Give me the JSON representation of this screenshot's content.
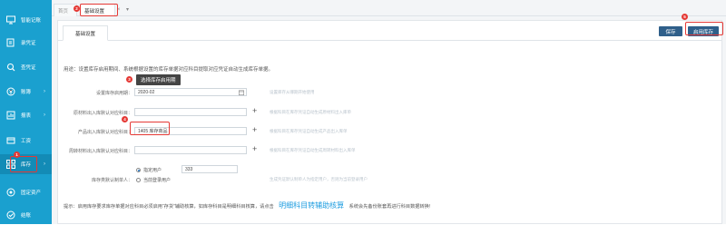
{
  "sidebar": {
    "items": [
      {
        "label": "智能记账",
        "icon": "monitor-icon",
        "has_arrow": false
      },
      {
        "label": "录凭证",
        "icon": "edit-voucher-icon",
        "has_arrow": false
      },
      {
        "label": "查凭证",
        "icon": "search-voucher-icon",
        "has_arrow": false
      },
      {
        "label": "账簿",
        "icon": "ledger-icon",
        "has_arrow": true
      },
      {
        "label": "报表",
        "icon": "report-icon",
        "has_arrow": true
      },
      {
        "label": "工资",
        "icon": "salary-icon",
        "has_arrow": false
      },
      {
        "label": "库存",
        "icon": "inventory-icon",
        "has_arrow": true
      },
      {
        "label": "固定资产",
        "icon": "asset-icon",
        "has_arrow": false
      },
      {
        "label": "结账",
        "icon": "close-account-icon",
        "has_arrow": false
      }
    ]
  },
  "tabs": {
    "home": "首页",
    "active": "基础设置",
    "close_glyph": "×",
    "more_glyph": "▾"
  },
  "panel": {
    "tab": "基础设置",
    "save_label": "保存",
    "enable_label": "启用库存"
  },
  "form": {
    "usage_text": "用途：设置库存启用期间、系统根据设置的库存单据对应科目提取对应凭证自动生成库存单据。",
    "start_period_label": "设置库存启用期：",
    "start_period_value": "2020-02",
    "raw_material_label": "原材料出入库默认对应科目：",
    "raw_material_value": "",
    "raw_material_hint": "根据科目在库存凭证自动生成原材料出入库单",
    "product_label": "产品出入库默认对应科目：",
    "product_value": "1405 库存商品",
    "product_hint": "根据科目在库存凭证自动生成产品出入库单",
    "turnover_label": "周转材料出入库默认对应科目：",
    "turnover_value": "",
    "turnover_hint": "根据科目在库存凭证自动生成周转材料出入库单",
    "default_user_label": "库存类默认制单人：",
    "radio_fixed": "指定用户",
    "radio_current": "当前登录用户",
    "fixed_user_value": "333",
    "default_user_hint": "生成凭证默认制单人为指定用户，否则为当前登录用户",
    "tooltip": "选择库存启用期",
    "footer_prefix": "提示：启用库存要求库存单据对应科目必须启用“存货”辅助核算，如库存科目是明细科目核算，请点击",
    "footer_link": "明细科目转辅助核算",
    "footer_suffix": "系统会先备份账套再进行科目数据转换!"
  },
  "badges": {
    "inventory": "1",
    "tab": "2",
    "tooltip": "3",
    "product": "4",
    "enable": "5"
  },
  "colors": {
    "sidebar": "#1aa0cf",
    "button": "#2f5f8a",
    "annotation": "#e53935",
    "link": "#1e9de0"
  }
}
